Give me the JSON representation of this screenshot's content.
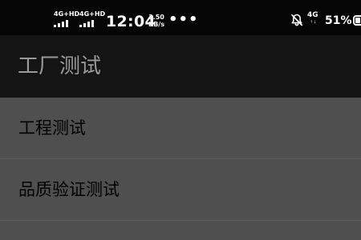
{
  "status_bar": {
    "sim1_network": "4G+HD",
    "sim2_network": "4G+HD",
    "time": "12:04",
    "speed_value": "3.50",
    "speed_unit": "KB/s",
    "more_indicator": "•••",
    "mute_icon": "bell-off-icon",
    "data_network": "4G",
    "data_network_sub": "↑↓",
    "battery_percent": "51%",
    "battery_level": 0.51
  },
  "app_bar": {
    "title": "工厂测试"
  },
  "list": {
    "items": [
      {
        "label": "工程测试"
      },
      {
        "label": "品质验证测试"
      }
    ]
  },
  "colors": {
    "status_bar_bg": "#050505",
    "app_bar_bg": "#141414",
    "list_bg": "#4f4f4f",
    "title_text": "#9a9a9a",
    "item_text": "#000000"
  }
}
